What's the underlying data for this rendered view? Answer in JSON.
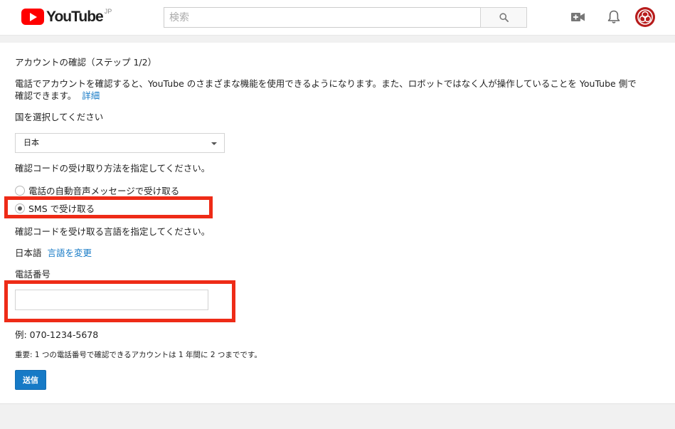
{
  "header": {
    "logo_text": "YouTube",
    "logo_region": "JP",
    "search_placeholder": "検索",
    "icons": [
      "youtube-logo-icon",
      "search-icon",
      "upload-video-icon",
      "bell-icon",
      "avatar"
    ],
    "brand_color": "#ff0000"
  },
  "page": {
    "heading": "アカウントの確認（ステップ 1/2）",
    "intro_line1": "電話でアカウントを確認すると、YouTube のさまざまな機能を使用できるようになります。また、ロボットではなく人が操作していることを YouTube 側で",
    "intro_line2": "確認できます。",
    "details_link": "詳細",
    "country_label": "国を選択してください",
    "country_value": "日本",
    "method_label": "確認コードの受け取り方法を指定してください。",
    "methods": [
      {
        "label": "電話の自動音声メッセージで受け取る",
        "selected": false
      },
      {
        "label": "SMS で受け取る",
        "selected": true
      }
    ],
    "language_prompt": "確認コードを受け取る言語を指定してください。",
    "language_value": "日本語",
    "change_language_link": "言語を変更",
    "phone_label": "電話番号",
    "phone_value": "",
    "example": "例: 070-1234-5678",
    "note": "重要: 1 つの電話番号で確認できるアカウントは 1 年間に 2 つまでです。",
    "submit_label": "送信"
  },
  "colors": {
    "highlight": "#ee2b17",
    "link": "#167ac6",
    "button": "#167ac6"
  }
}
